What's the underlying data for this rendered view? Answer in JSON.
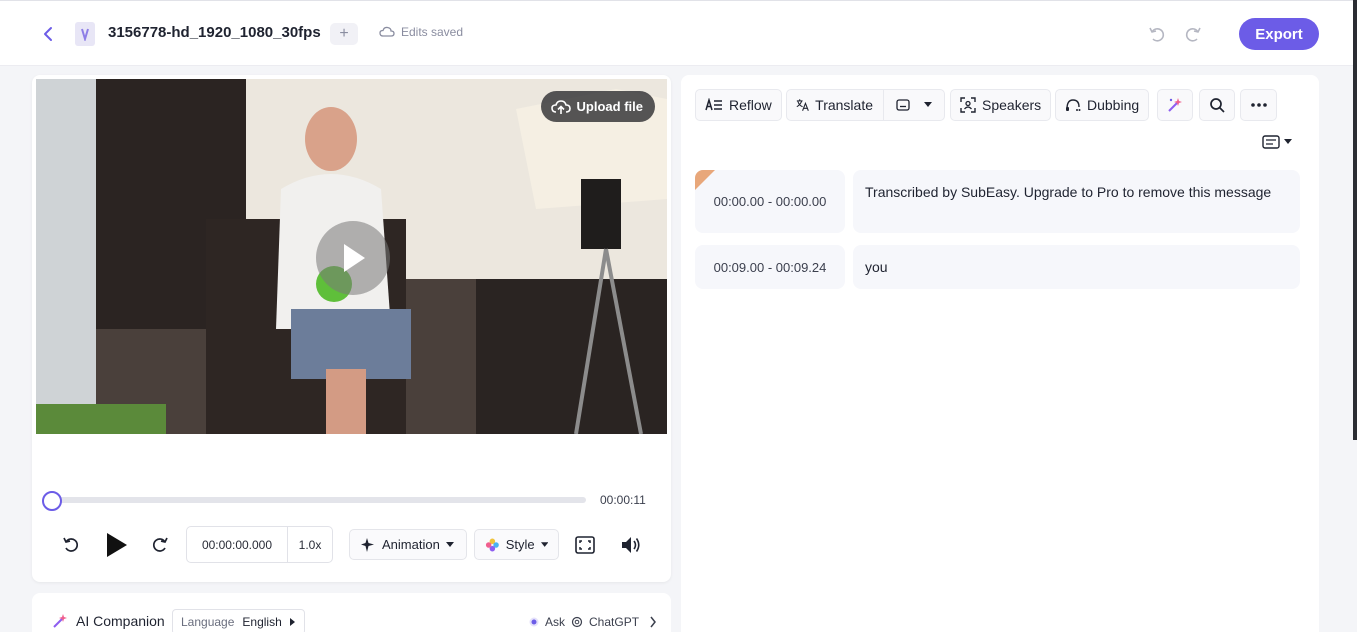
{
  "header": {
    "file_name": "3156778-hd_1920_1080_30fps",
    "add_label": "+",
    "saved_status": "Edits saved",
    "export_label": "Export"
  },
  "player": {
    "upload_label": "Upload file",
    "duration": "00:00:11",
    "progress": 0.0,
    "current_time": "00:00:00.000",
    "speed": "1.0x",
    "animation_label": "Animation",
    "style_label": "Style"
  },
  "ai_companion": {
    "title": "AI Companion",
    "language_label": "Language",
    "language_value": "English",
    "ask_label": "Ask",
    "ask_target": "ChatGPT"
  },
  "toolbar": {
    "reflow_label": "Reflow",
    "translate_label": "Translate",
    "speakers_label": "Speakers",
    "dubbing_label": "Dubbing"
  },
  "subtitles": [
    {
      "time": "00:00.00 - 00:00.00",
      "text": "Transcribed by SubEasy. Upgrade to Pro to remove this message"
    },
    {
      "time": "00:09.00 - 00:09.24",
      "text": "you"
    }
  ],
  "colors": {
    "accent": "#6c5ce7",
    "marker": "#e8a77a"
  }
}
